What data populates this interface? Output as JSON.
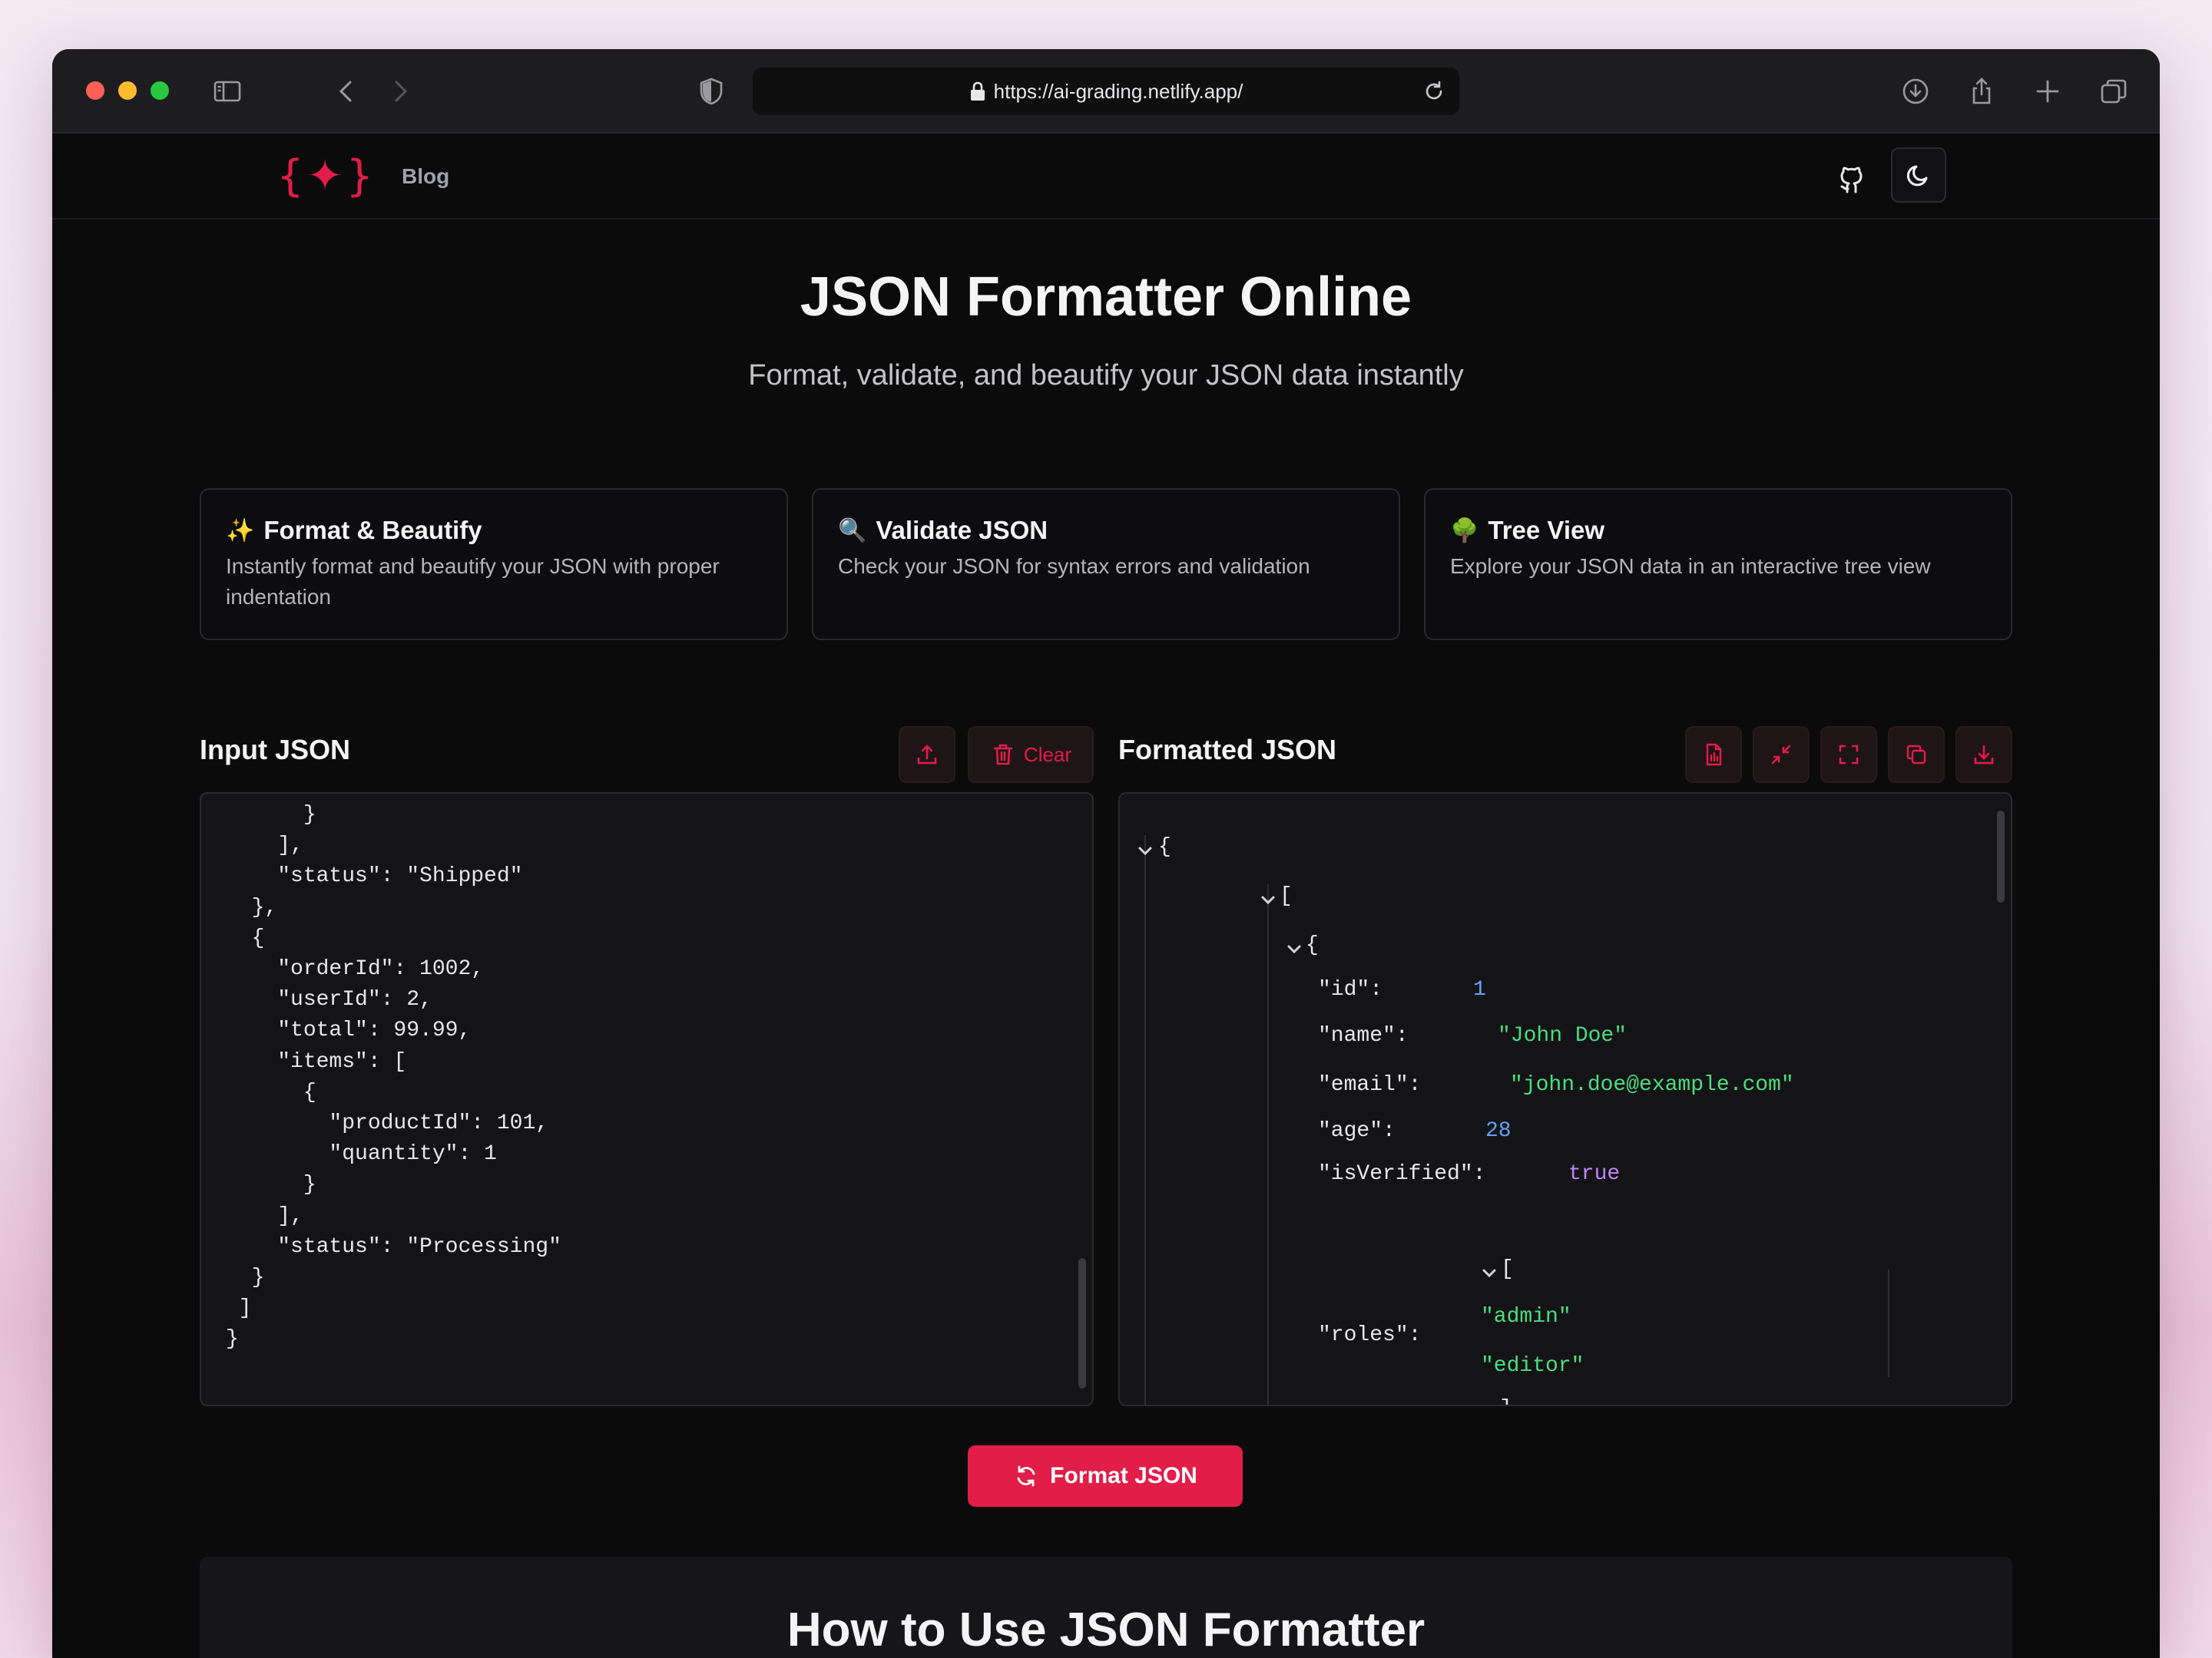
{
  "browser": {
    "url": "https://ai-grading.netlify.app/",
    "colors": {
      "close": "#ff5f57",
      "minimize": "#febc2e",
      "maximize": "#28c840"
    }
  },
  "nav": {
    "logo_text": "{✦}",
    "blog_label": "Blog"
  },
  "hero": {
    "title": "JSON Formatter Online",
    "subtitle": "Format, validate, and beautify your JSON data instantly"
  },
  "features": [
    {
      "emoji": "✨",
      "title": "Format & Beautify",
      "description": "Instantly format and beautify your JSON with proper indentation"
    },
    {
      "emoji": "🔍",
      "title": "Validate JSON",
      "description": "Check your JSON for syntax errors and validation"
    },
    {
      "emoji": "🌳",
      "title": "Tree View",
      "description": "Explore your JSON data in an interactive tree view"
    }
  ],
  "input_panel": {
    "title": "Input JSON",
    "clear_label": "Clear",
    "code": "      }\n    ],\n    \"status\": \"Shipped\"\n  },\n  {\n    \"orderId\": 1002,\n    \"userId\": 2,\n    \"total\": 99.99,\n    \"items\": [\n      {\n        \"productId\": 101,\n        \"quantity\": 1\n      }\n    ],\n    \"status\": \"Processing\"\n  }\n ]\n}"
  },
  "output_panel": {
    "title": "Formatted JSON",
    "tree": {
      "open_brace": "{",
      "open_bracket": "[",
      "close_bracket": "]",
      "id_key": "\"id\":",
      "id_val": "1",
      "name_key": "\"name\":",
      "name_val": "\"John Doe\"",
      "email_key": "\"email\":",
      "email_val": "\"john.doe@example.com\"",
      "age_key": "\"age\":",
      "age_val": "28",
      "verified_key": "\"isVerified\":",
      "verified_val": "true",
      "roles_key": "\"roles\":",
      "role_1": "\"admin\"",
      "role_2": "\"editor\""
    }
  },
  "format_button_label": "Format JSON",
  "howto_title": "How to Use JSON Formatter",
  "accent_color": "#e11d48"
}
